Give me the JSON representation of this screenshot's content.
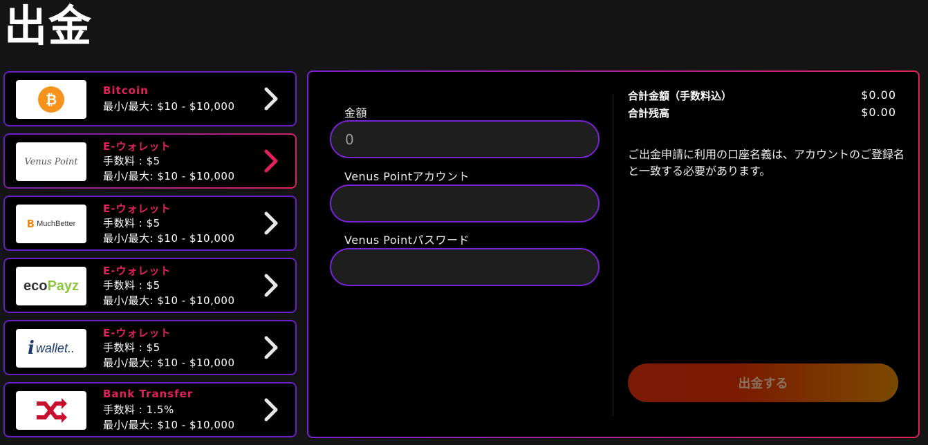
{
  "page": {
    "title": "出金"
  },
  "methods": [
    {
      "logo": "Bitcoin logo",
      "name": "Bitcoin",
      "line1": "最小/最大: $10 - $10,000"
    },
    {
      "logo": "Venus Point logo",
      "logo_text": "Venus Point",
      "name": "E-ウォレット",
      "line1": "手数料 : $5",
      "line2": "最小/最大: $10 - $10,000"
    },
    {
      "logo": "MuchBetter logo",
      "logo_text": "MuchBetter",
      "name": "E-ウォレット",
      "line1": "手数料 : $5",
      "line2": "最小/最大: $10 - $10,000"
    },
    {
      "logo": "ecoPayz logo",
      "logo_text_a": "eco",
      "logo_text_b": "Payz",
      "name": "E-ウォレット",
      "line1": "手数料 : $5",
      "line2": "最小/最大: $10 - $10,000"
    },
    {
      "logo": "iWallet logo",
      "logo_text": "wallet..",
      "name": "E-ウォレット",
      "line1": "手数料 : $5",
      "line2": "最小/最大: $10 - $10,000"
    },
    {
      "logo": "Bank transfer logo",
      "name": "Bank Transfer",
      "line1": "手数料 : 1.5%",
      "line2": "最小/最大: $10 - $10,000"
    }
  ],
  "form": {
    "amount_label": "金額",
    "amount_value": "0",
    "account_label": "Venus Pointアカウント",
    "account_value": "",
    "password_label": "Venus Pointパスワード",
    "password_value": ""
  },
  "summary": {
    "total_label": "合計金額（手数料込）",
    "total_value": "$0.00",
    "balance_label": "合計残高",
    "balance_value": "$0.00",
    "notice": "ご出金申請に利用の口座名義は、アカウントのご登録名と一致する必要があります。"
  },
  "submit_label": "出金する",
  "colors": {
    "accent_pink": "#e3225c",
    "border_purple": "#6a1fc4",
    "bitcoin_orange": "#f7931a"
  },
  "icons": {
    "chevron": "chevron-right-icon"
  }
}
